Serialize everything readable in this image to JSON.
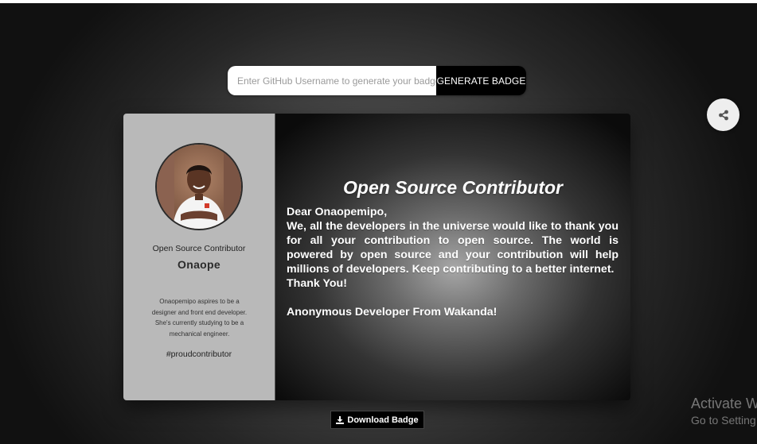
{
  "search": {
    "placeholder": "Enter GitHub Username to generate your badge",
    "button_label": "GENERATE BADGE"
  },
  "share": {
    "icon": "share-icon"
  },
  "badge": {
    "profile": {
      "role": "Open Source Contributor",
      "name": "Onaope",
      "bio": "Onaopemipo aspires to be a designer and front end developer. She's currently studying to be a mechanical engineer.",
      "hashtag": "#proudcontributor"
    },
    "letter": {
      "title": "Open Source Contributor",
      "greeting": "Dear Onaopemipo,",
      "body": "We, all the developers in the universe would like to thank you for all your contribution to open source. The world is powered by open source and your contribution will help millions of developers. Keep contributing to a better internet.",
      "thanks": "Thank You!",
      "signature": "Anonymous Developer From Wakanda!"
    }
  },
  "download": {
    "label": "Download Badge",
    "icon": "download-icon"
  },
  "watermark": {
    "title": "Activate W",
    "subtitle": "Go to Setting"
  },
  "colors": {
    "button_bg": "#000000",
    "card_left_bg": "#b9b9b9",
    "text_light": "#ffffff"
  }
}
